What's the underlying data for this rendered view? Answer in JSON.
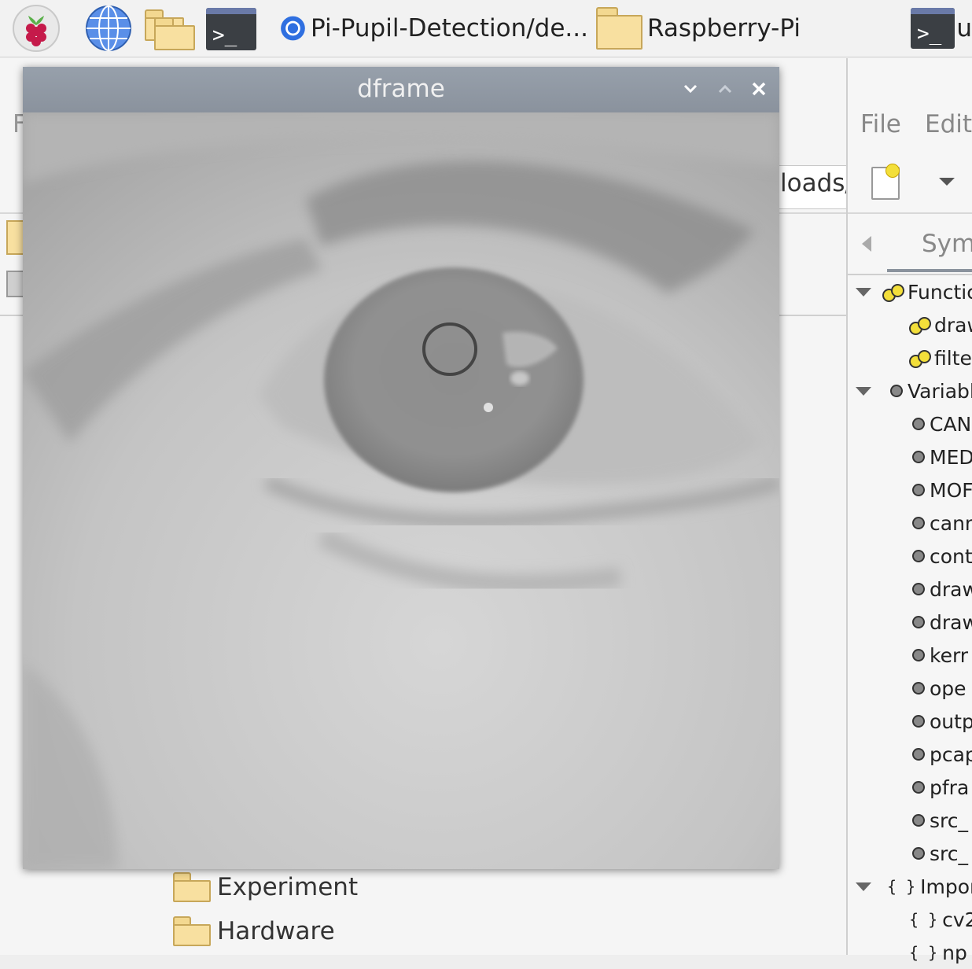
{
  "taskbar": {
    "browser_task": "Pi-Pupil-Detection/de...",
    "folder_task": "Raspberry-Pi",
    "terminal_glyph": ">_",
    "terminal_trunc": "u",
    "icons": [
      "raspberry-menu-icon",
      "globe-browser-icon",
      "folders-icon",
      "terminal-icon",
      "chromium-icon",
      "folder-icon",
      "terminal-icon"
    ]
  },
  "dframe": {
    "title": "dframe",
    "controls": {
      "minimize": "⌄",
      "maximize": "⌃",
      "close": "✕"
    }
  },
  "file_manager": {
    "path_fragment": "loads/",
    "partial_menu": "F",
    "items": [
      {
        "name": "Experiment",
        "icon": "folder-icon"
      },
      {
        "name": "Hardware",
        "icon": "folder-icon"
      }
    ]
  },
  "ide": {
    "menu": [
      "File",
      "Edit"
    ],
    "sidebar_tab": "Sym",
    "tree": [
      {
        "label": "Functic",
        "kind": "group-functions",
        "level": 0
      },
      {
        "label": "draw",
        "kind": "function",
        "level": 1
      },
      {
        "label": "filte",
        "kind": "function",
        "level": 1
      },
      {
        "label": "Variabl",
        "kind": "group-variables",
        "level": 0
      },
      {
        "label": "CAN",
        "kind": "variable",
        "level": 1
      },
      {
        "label": "MED",
        "kind": "variable",
        "level": 1
      },
      {
        "label": "MOF",
        "kind": "variable",
        "level": 1
      },
      {
        "label": "cann",
        "kind": "variable",
        "level": 1
      },
      {
        "label": "cont",
        "kind": "variable",
        "level": 1
      },
      {
        "label": "draw",
        "kind": "variable",
        "level": 1
      },
      {
        "label": "draw",
        "kind": "variable",
        "level": 1
      },
      {
        "label": "kerr",
        "kind": "variable",
        "level": 1
      },
      {
        "label": "ope",
        "kind": "variable",
        "level": 1
      },
      {
        "label": "outp",
        "kind": "variable",
        "level": 1
      },
      {
        "label": "pcap",
        "kind": "variable",
        "level": 1
      },
      {
        "label": "pfra",
        "kind": "variable",
        "level": 1
      },
      {
        "label": "src_",
        "kind": "variable",
        "level": 1
      },
      {
        "label": "src_",
        "kind": "variable",
        "level": 1
      },
      {
        "label": "Import",
        "kind": "group-imports",
        "level": 0
      },
      {
        "label": "cv2",
        "kind": "import",
        "level": 1
      },
      {
        "label": "np",
        "kind": "import",
        "level": 1
      }
    ]
  },
  "colors": {
    "title_bar": "#8e97a3",
    "folder": "#f8e0a0",
    "accent_blue": "#2f6fe0"
  }
}
